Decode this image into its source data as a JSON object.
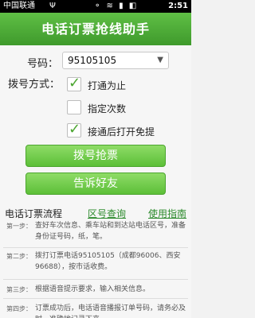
{
  "status_bar": {
    "carrier": "中国联通",
    "usb": "Ψ",
    "icons": "⚬ ≋ ▮ ◧",
    "time": "2:51"
  },
  "title": "电话订票抢线助手",
  "form": {
    "phone_label": "号码：",
    "phone_value": "95105105",
    "dial_label": "拨号方式：",
    "options": [
      {
        "label": "打通为止",
        "checked": true
      },
      {
        "label": "指定次数",
        "checked": false
      },
      {
        "label": "接通后打开免提",
        "checked": true
      }
    ]
  },
  "buttons": {
    "dial": "拨号抢票",
    "share": "告诉好友"
  },
  "flow": {
    "title": "电话订票流程",
    "link_area": "区号查询",
    "link_guide": "使用指南",
    "steps": [
      {
        "no": "第一步：",
        "text": "查好车次信息、乘车站和到达站电话区号，准备身份证号码，纸，笔。"
      },
      {
        "no": "第二步：",
        "text": "拨打订票电话95105105（成都96006、西安96688），按市话收费。"
      },
      {
        "no": "第三步：",
        "text": "根据语音提示要求，输入相关信息。"
      },
      {
        "no": "第四步：",
        "text": "订票成功后，电话语音播报订单号码，请务必及时、准确地记录下来。"
      }
    ]
  }
}
